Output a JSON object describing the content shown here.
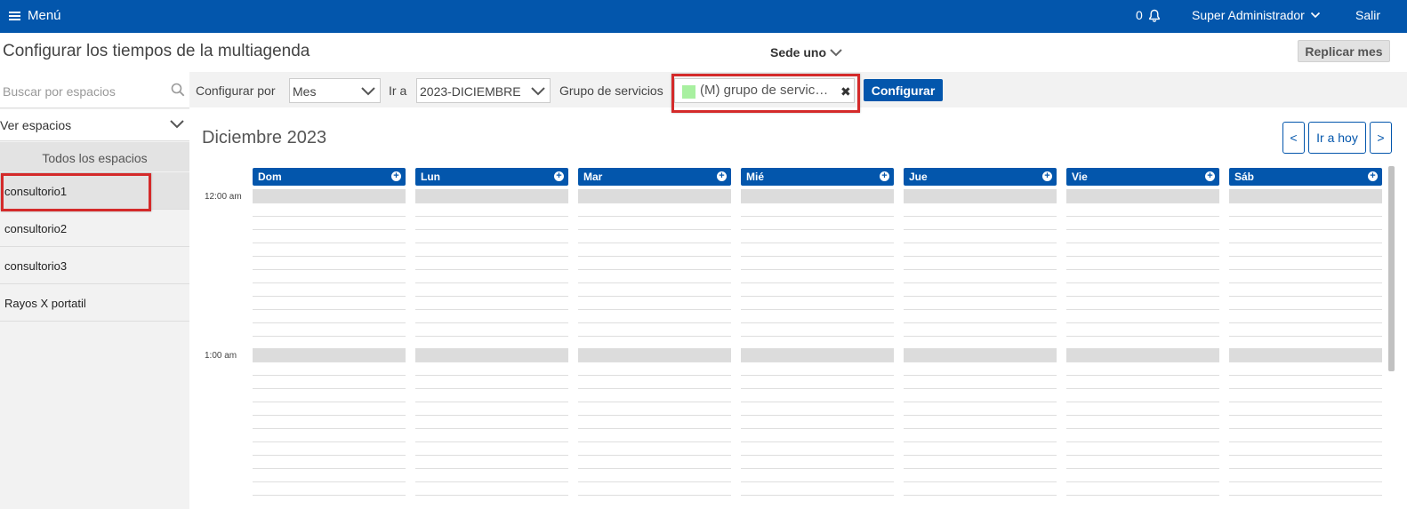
{
  "topbar": {
    "menu_label": "Menú",
    "notifications_count": "0",
    "user_name": "Super Administrador",
    "logout_label": "Salir"
  },
  "header": {
    "title": "Configurar los tiempos de la multiagenda",
    "sede": "Sede uno",
    "replicate_label": "Replicar mes"
  },
  "sidebar": {
    "search_placeholder": "Buscar por espacios",
    "view_label": "Ver espacios",
    "all_label": "Todos los espacios",
    "items": [
      {
        "label": "consultorio1"
      },
      {
        "label": "consultorio2"
      },
      {
        "label": "consultorio3"
      },
      {
        "label": "Rayos X portatil"
      }
    ]
  },
  "filters": {
    "configure_by_label": "Configurar por",
    "configure_by_value": "Mes",
    "goto_label": "Ir a",
    "goto_value": "2023-DICIEMBRE",
    "group_label": "Grupo de servicios",
    "group_chip": "(M) grupo de servic…",
    "group_chip_color": "#a8f0a0",
    "configure_button": "Configurar"
  },
  "calendar": {
    "title": "Diciembre 2023",
    "prev_label": "<",
    "today_label": "Ir a hoy",
    "next_label": ">",
    "days": [
      "Dom",
      "Lun",
      "Mar",
      "Mié",
      "Jue",
      "Vie",
      "Sáb"
    ],
    "times": [
      "12:00 am",
      "1:00 am"
    ]
  },
  "colors": {
    "primary": "#0356ac",
    "highlight": "#d42a2a"
  }
}
